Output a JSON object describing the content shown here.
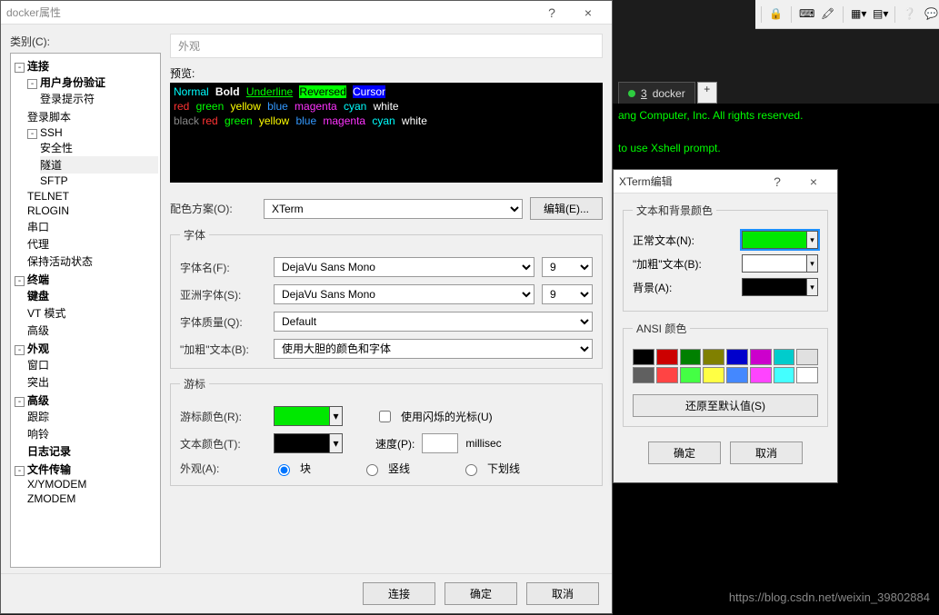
{
  "bg": {
    "tab_number": "3",
    "tab_name": "docker",
    "term_line1": "ang Computer, Inc. All rights reserved.",
    "term_line2": "to use Xshell prompt.",
    "watermark": "https://blog.csdn.net/weixin_39802884"
  },
  "dlg": {
    "title": "docker属性",
    "help": "?",
    "close": "×",
    "category_label": "类别(C):",
    "panel_title": "外观",
    "preview_label": "预览:",
    "preview": {
      "l1": {
        "normal": "Normal",
        "bold": "Bold",
        "under": "Underline",
        "rev": "Reversed",
        "cur": "Cursor"
      },
      "l2_pre": "      ",
      "l2": {
        "red": "red",
        "green": "green",
        "yellow": "yellow",
        "blue": "blue",
        "mag": "magenta",
        "cyan": "cyan",
        "white": "white"
      },
      "l3_pre": "black ",
      "l3": {
        "red": "red",
        "green": "green",
        "yellow": "yellow",
        "blue": "blue",
        "mag": "magenta",
        "cyan": "cyan",
        "white": "white"
      }
    },
    "scheme_label": "配色方案(O):",
    "scheme_value": "XTerm",
    "edit_btn": "编辑(E)...",
    "font_legend": "字体",
    "fontname_label": "字体名(F):",
    "fontname_value": "DejaVu Sans Mono",
    "fontsize1": "9",
    "asianfont_label": "亚洲字体(S):",
    "asianfont_value": "DejaVu Sans Mono",
    "fontsize2": "9",
    "quality_label": "字体质量(Q):",
    "quality_value": "Default",
    "boldtext_label": "\"加粗\"文本(B):",
    "boldtext_value": "使用大胆的颜色和字体",
    "cursor_legend": "游标",
    "cursor_color_label": "游标颜色(R):",
    "cursor_color": "#00e800",
    "blink_label": "使用闪烁的光标(U)",
    "text_color_label": "文本颜色(T):",
    "text_color": "#000000",
    "speed_label": "速度(P):",
    "speed_unit": "millisec",
    "appearance_label": "外观(A):",
    "r_block": "块",
    "r_vert": "竖线",
    "r_under": "下划线",
    "footer": {
      "connect": "连接",
      "ok": "确定",
      "cancel": "取消"
    }
  },
  "tree": {
    "conn": "连接",
    "auth": "用户身份验证",
    "prompt": "登录提示符",
    "script": "登录脚本",
    "ssh": "SSH",
    "sec": "安全性",
    "tunnel": "隧道",
    "sftp": "SFTP",
    "telnet": "TELNET",
    "rlogin": "RLOGIN",
    "serial": "串口",
    "proxy": "代理",
    "keep": "保持活动状态",
    "term": "终端",
    "kbd": "键盘",
    "vt": "VT 模式",
    "adv1": "高级",
    "look": "外观",
    "win": "窗口",
    "margin": "突出",
    "adv": "高级",
    "trace": "跟踪",
    "bell": "响铃",
    "log": "日志记录",
    "file": "文件传输",
    "xym": "X/YMODEM",
    "zm": "ZMODEM"
  },
  "dlg2": {
    "title": "XTerm编辑",
    "help": "?",
    "close": "×",
    "fs1": "文本和背景颜色",
    "normal_label": "正常文本(N):",
    "normal_color": "#00e800",
    "bold_label": "\"加粗\"文本(B):",
    "bold_color": "#ffffff",
    "bg_label": "背景(A):",
    "bg_color": "#000000",
    "fs2": "ANSI 颜色",
    "ansi": [
      "#000000",
      "#cc0000",
      "#008000",
      "#808000",
      "#0000cc",
      "#cc00cc",
      "#00cccc",
      "#e0e0e0",
      "#606060",
      "#ff4444",
      "#44ff44",
      "#ffff44",
      "#4488ff",
      "#ff44ff",
      "#44ffff",
      "#ffffff"
    ],
    "restore": "还原至默认值(S)",
    "ok": "确定",
    "cancel": "取消"
  }
}
